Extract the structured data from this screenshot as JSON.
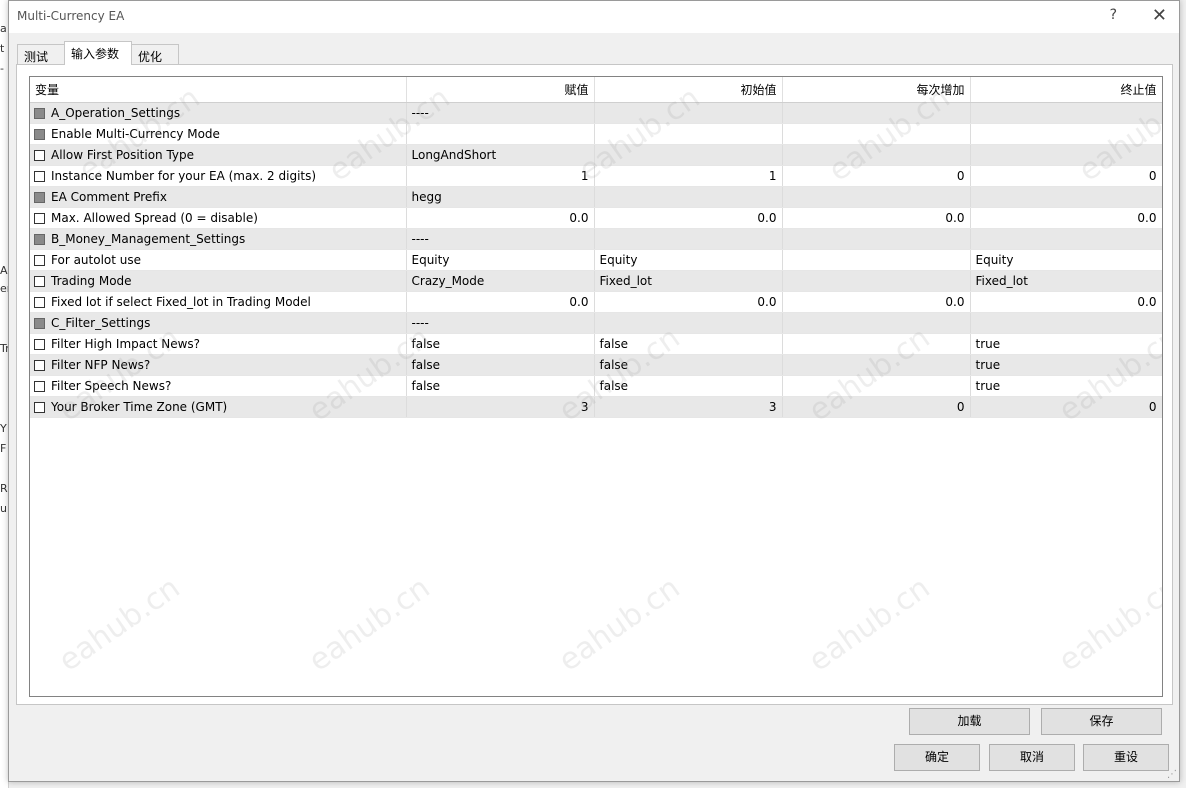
{
  "window": {
    "title": "Multi-Currency EA",
    "help": "?",
    "close": "✕"
  },
  "tabs": [
    {
      "label": "测试"
    },
    {
      "label": "输入参数"
    },
    {
      "label": "优化"
    }
  ],
  "columns": [
    "变量",
    "赋值",
    "初始值",
    "每次增加",
    "终止值"
  ],
  "rows": [
    {
      "name": "A_Operation_Settings",
      "value": "----",
      "start": "",
      "step": "",
      "stop": "",
      "checked_gray": true
    },
    {
      "name": "Enable Multi-Currency Mode",
      "value": "",
      "start": "",
      "step": "",
      "stop": "",
      "checked_gray": true
    },
    {
      "name": "Allow First Position Type",
      "value": "LongAndShort",
      "start": "",
      "step": "",
      "stop": "",
      "checked_gray": false
    },
    {
      "name": "Instance Number for your EA (max. 2 digits)",
      "value": "1",
      "start": "1",
      "step": "0",
      "stop": "0",
      "checked_gray": false
    },
    {
      "name": "EA Comment Prefix",
      "value": "hegg",
      "start": "",
      "step": "",
      "stop": "",
      "checked_gray": true
    },
    {
      "name": "Max. Allowed Spread (0 = disable)",
      "value": "0.0",
      "start": "0.0",
      "step": "0.0",
      "stop": "0.0",
      "checked_gray": false
    },
    {
      "name": "B_Money_Management_Settings",
      "value": "----",
      "start": "",
      "step": "",
      "stop": "",
      "checked_gray": true
    },
    {
      "name": "For autolot use",
      "value": "Equity",
      "start": "Equity",
      "step": "",
      "stop": "Equity",
      "checked_gray": false
    },
    {
      "name": "Trading Mode",
      "value": "Crazy_Mode",
      "start": "Fixed_lot",
      "step": "",
      "stop": "Fixed_lot",
      "checked_gray": false
    },
    {
      "name": "Fixed lot if select Fixed_lot in Trading Model",
      "value": "0.0",
      "start": "0.0",
      "step": "0.0",
      "stop": "0.0",
      "checked_gray": false
    },
    {
      "name": "C_Filter_Settings",
      "value": "----",
      "start": "",
      "step": "",
      "stop": "",
      "checked_gray": true
    },
    {
      "name": "Filter High Impact News?",
      "value": "false",
      "start": "false",
      "step": "",
      "stop": "true",
      "checked_gray": false
    },
    {
      "name": "Filter NFP News?",
      "value": "false",
      "start": "false",
      "step": "",
      "stop": "true",
      "checked_gray": false
    },
    {
      "name": "Filter Speech News?",
      "value": "false",
      "start": "false",
      "step": "",
      "stop": "true",
      "checked_gray": false
    },
    {
      "name": "Your Broker Time Zone (GMT)",
      "value": "3",
      "start": "3",
      "step": "0",
      "stop": "0",
      "checked_gray": false
    }
  ],
  "watermark": "eahub.cn",
  "buttons": {
    "load": "加载",
    "save": "保存",
    "ok": "确定",
    "cancel": "取消",
    "reset": "重设"
  }
}
